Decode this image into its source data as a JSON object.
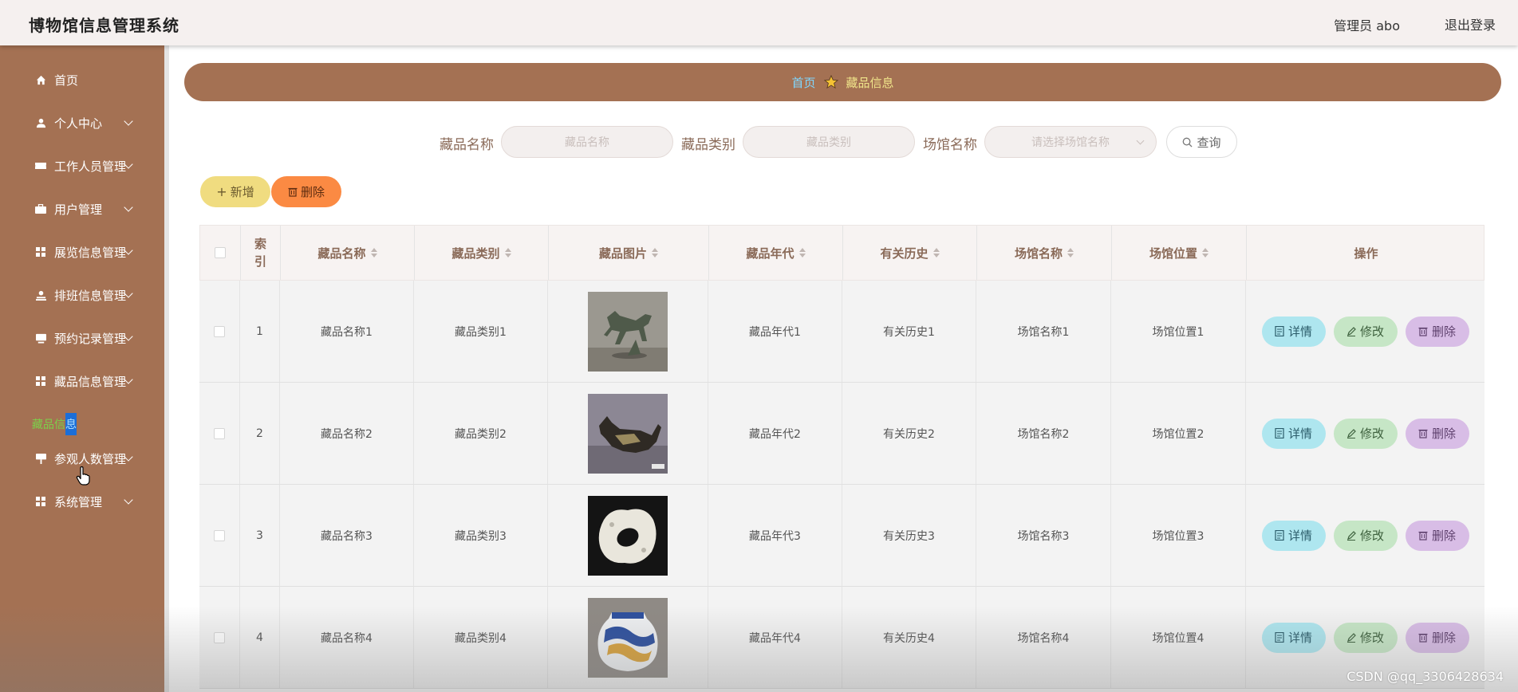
{
  "header": {
    "title": "博物馆信息管理系统",
    "user": "管理员 abo",
    "logout": "退出登录"
  },
  "sidebar": {
    "items": [
      {
        "label": "首页",
        "icon": "home-icon",
        "arrow": false
      },
      {
        "label": "个人中心",
        "icon": "user-icon",
        "arrow": true
      },
      {
        "label": "工作人员管理",
        "icon": "ticket-icon",
        "arrow": true
      },
      {
        "label": "用户管理",
        "icon": "briefcase-icon",
        "arrow": true
      },
      {
        "label": "展览信息管理",
        "icon": "grid-icon",
        "arrow": true
      },
      {
        "label": "排班信息管理",
        "icon": "person-stamp-icon",
        "arrow": true
      },
      {
        "label": "预约记录管理",
        "icon": "monitor-icon",
        "arrow": true
      },
      {
        "label": "藏品信息管理",
        "icon": "grid-icon",
        "arrow": true
      },
      {
        "label": "参观人数管理",
        "icon": "sign-icon",
        "arrow": true
      },
      {
        "label": "系统管理",
        "icon": "grid-icon",
        "arrow": true
      }
    ],
    "active_sub": {
      "label_a": "藏品信",
      "label_b": "息"
    }
  },
  "breadcrumb": {
    "home": "首页",
    "current": "藏品信息"
  },
  "search": {
    "name_label": "藏品名称",
    "name_placeholder": "藏品名称",
    "type_label": "藏品类别",
    "type_placeholder": "藏品类别",
    "venue_label": "场馆名称",
    "venue_placeholder": "请选择场馆名称",
    "query": "查询"
  },
  "actions": {
    "add": "新增",
    "delete": "删除"
  },
  "table": {
    "columns": [
      "索引",
      "藏品名称",
      "藏品类别",
      "藏品图片",
      "藏品年代",
      "有关历史",
      "场馆名称",
      "场馆位置",
      "操作"
    ],
    "rows": [
      {
        "index": "1",
        "name": "藏品名称1",
        "type": "藏品类别1",
        "image": "bronze-horse-image",
        "era": "藏品年代1",
        "history": "有关历史1",
        "venue": "场馆名称1",
        "location": "场馆位置1"
      },
      {
        "index": "2",
        "name": "藏品名称2",
        "type": "藏品类别2",
        "image": "bronze-beast-image",
        "era": "藏品年代2",
        "history": "有关历史2",
        "venue": "场馆名称2",
        "location": "场馆位置2"
      },
      {
        "index": "3",
        "name": "藏品名称3",
        "type": "藏品类别3",
        "image": "jade-ring-image",
        "era": "藏品年代3",
        "history": "有关历史3",
        "venue": "场馆名称3",
        "location": "场馆位置3"
      },
      {
        "index": "4",
        "name": "藏品名称4",
        "type": "藏品类别4",
        "image": "porcelain-jar-image",
        "era": "藏品年代4",
        "history": "有关历史4",
        "venue": "场馆名称4",
        "location": "场馆位置4"
      }
    ],
    "op_detail": "详情",
    "op_edit": "修改",
    "op_delete": "删除"
  },
  "watermark": "CSDN @qq_3306428634",
  "colors": {
    "brand": "#a47153",
    "add": "#f0dc80",
    "delete": "#fb8a43",
    "detail": "#aee6ef",
    "edit": "#c6e6c6",
    "remove": "#d8bde6"
  }
}
